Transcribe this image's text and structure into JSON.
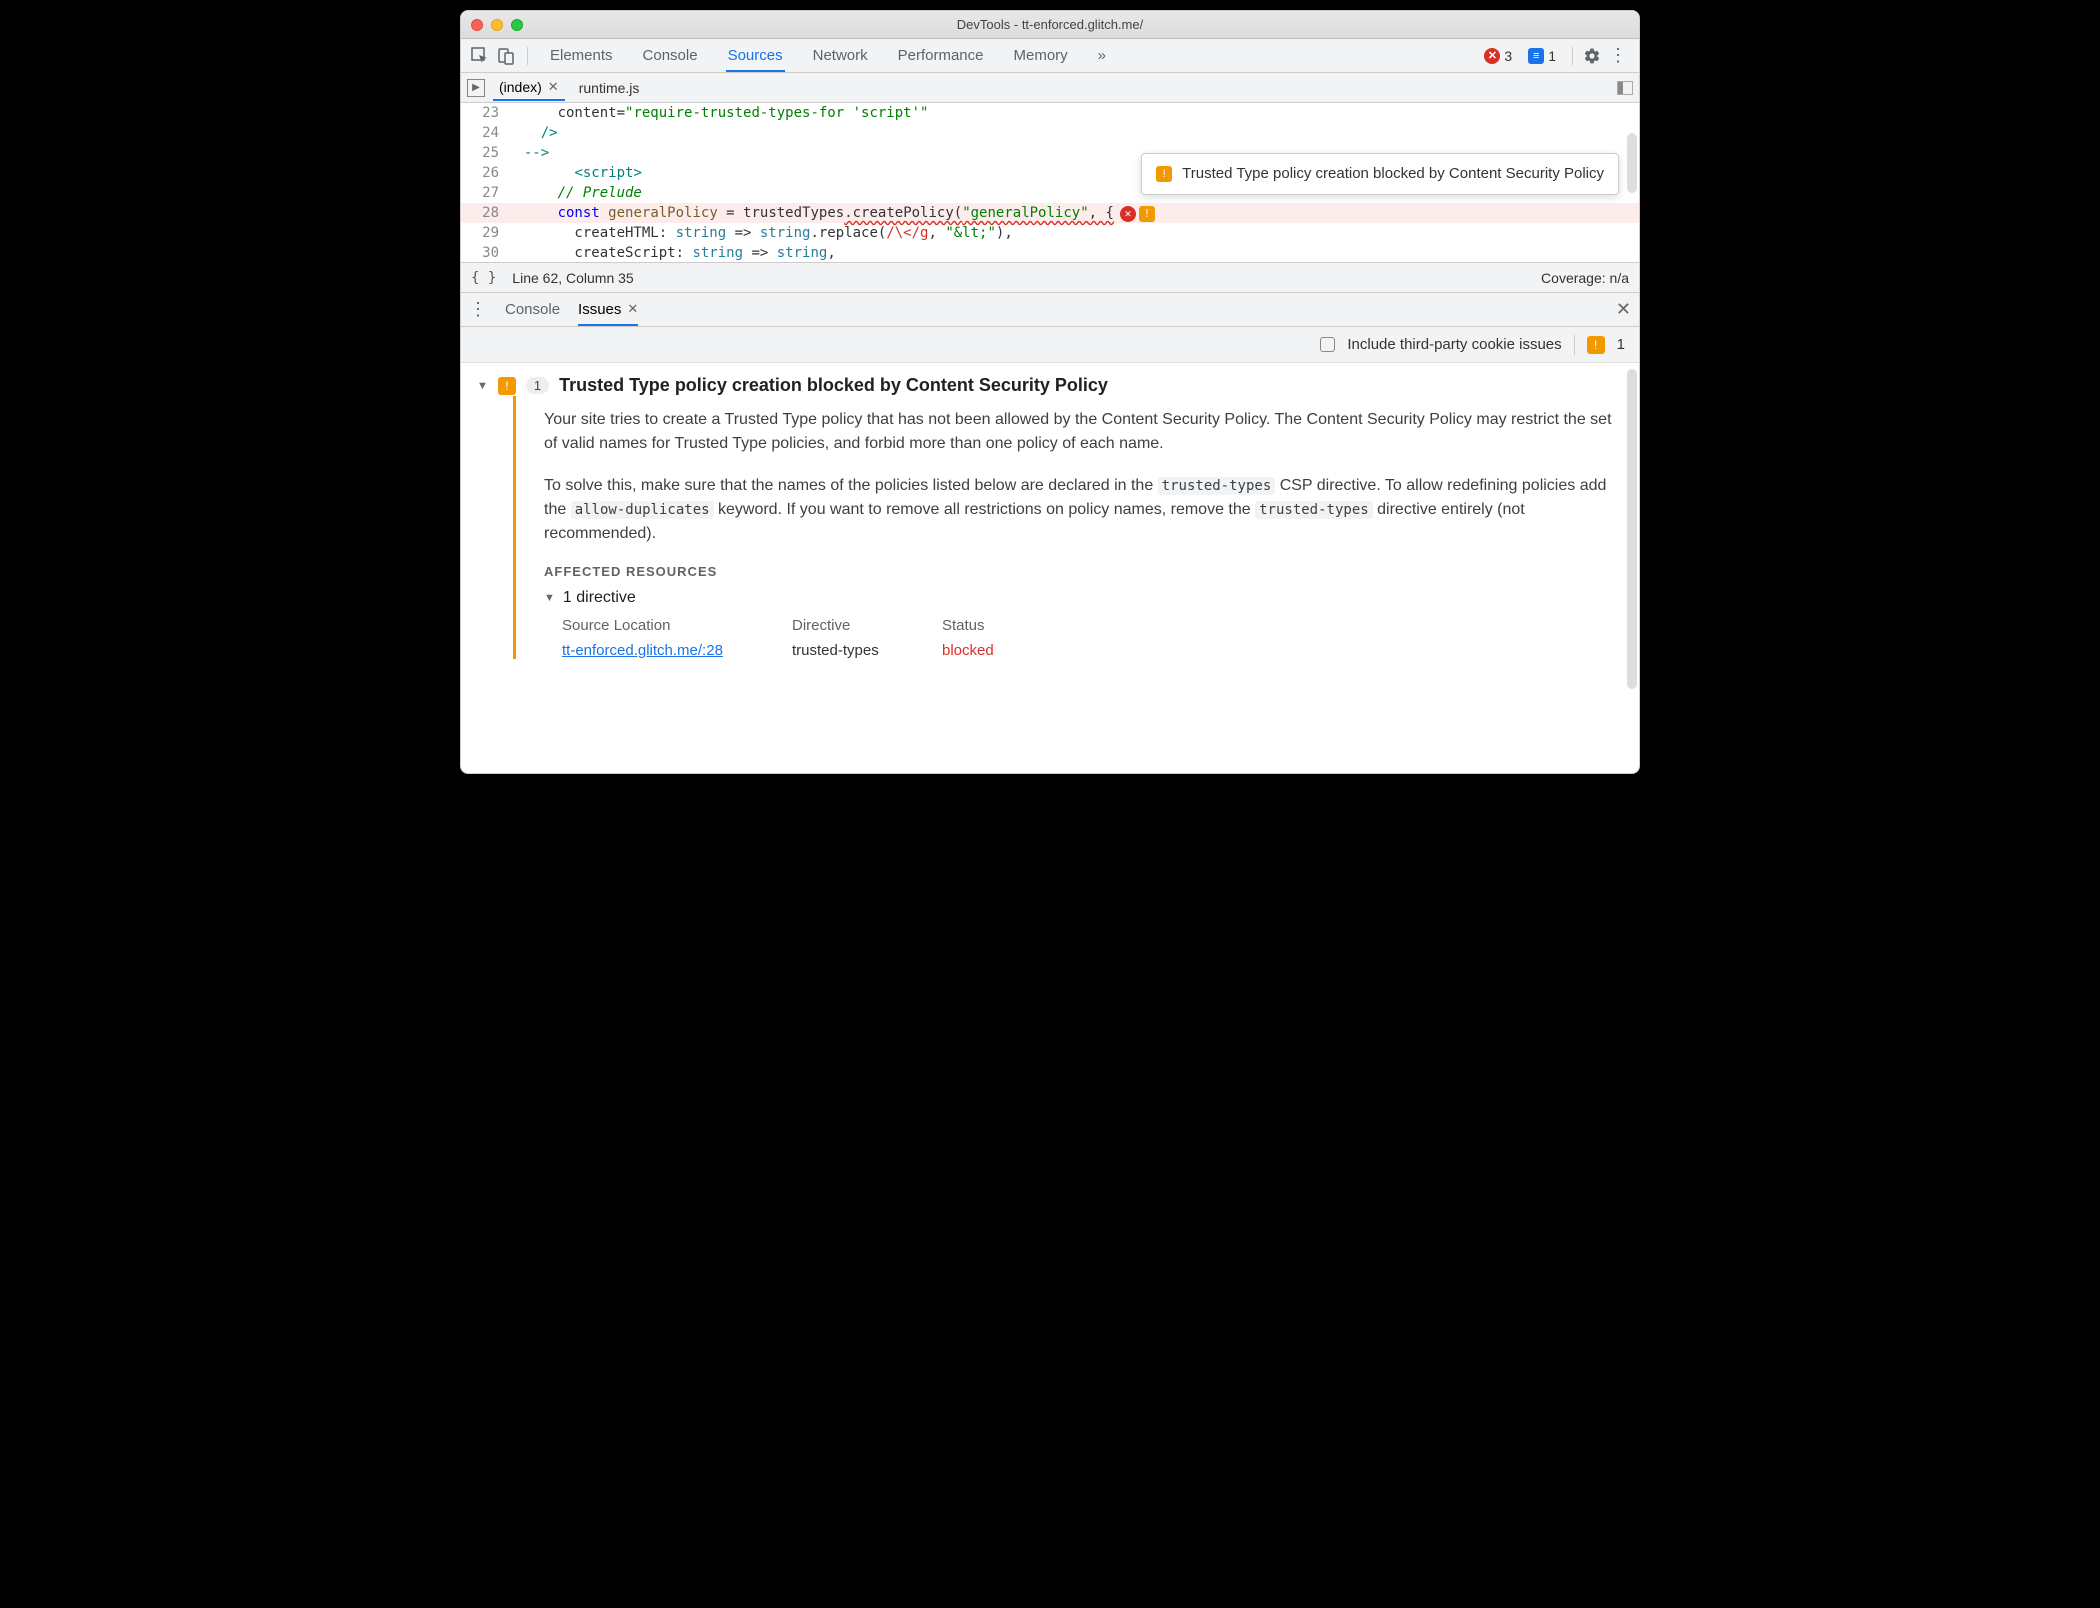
{
  "window": {
    "title": "DevTools - tt-enforced.glitch.me/"
  },
  "toolbar": {
    "tabs": [
      "Elements",
      "Console",
      "Sources",
      "Network",
      "Performance",
      "Memory"
    ],
    "activeTab": "Sources",
    "overflow": "»",
    "errorCount": "3",
    "messageCount": "1"
  },
  "fileTabs": {
    "items": [
      {
        "label": "(index)",
        "active": true,
        "closeable": true
      },
      {
        "label": "runtime.js",
        "active": false,
        "closeable": false
      }
    ]
  },
  "code": {
    "lines": [
      {
        "n": "23",
        "html": "      content=<span class='k-str'>\"require-trusted-types-for 'script'\"</span>"
      },
      {
        "n": "24",
        "html": "    <span class='k-tag'>/&gt;</span>"
      },
      {
        "n": "25",
        "html": "  <span class='k-tag'>--&gt;</span>"
      },
      {
        "n": "26",
        "html": "        <span class='k-tag'>&lt;script&gt;</span>"
      },
      {
        "n": "27",
        "html": "      <span class='k-comment'>// Prelude</span>"
      },
      {
        "n": "28",
        "hl": true,
        "html": "      <span class='k-kw'>const</span> <span class='k-var'>generalPolicy</span> = trustedTypes<span class='squig'>.createPolicy(</span><span class='k-str squig'>\"generalPolicy\"</span><span class='squig'>, {</span><span class='ln-err'><span class='lerr'>✕</span><span class='lwarn'>!</span></span>"
      },
      {
        "n": "29",
        "html": "        createHTML: <span class='k-type'>string</span> =&gt; <span class='k-type'>string</span>.replace(<span class='k-regex'>/\\&lt;/g</span>, <span class='k-str'>\"&amp;lt;\"</span>),"
      },
      {
        "n": "30",
        "html": "        createScript: <span class='k-type'>string</span> =&gt; <span class='k-type'>string</span>,"
      }
    ]
  },
  "tooltip": {
    "text": "Trusted Type policy creation blocked by Content Security Policy"
  },
  "status": {
    "pos": "Line 62, Column 35",
    "coverage": "Coverage: n/a"
  },
  "drawer": {
    "tabs": [
      "Console",
      "Issues"
    ],
    "activeTab": "Issues",
    "filterLabel": "Include third-party cookie issues",
    "warnCount": "1"
  },
  "issue": {
    "count": "1",
    "title": "Trusted Type policy creation blocked by Content Security Policy",
    "p1a": "Your site tries to create a Trusted Type policy that has not been allowed by the Content Security Policy. The Content Security Policy may restrict the set of valid names for Trusted Type policies, and forbid more than one policy of each name.",
    "p2_1": "To solve this, make sure that the names of the policies listed below are declared in the ",
    "p2_c1": "trusted-types",
    "p2_2": " CSP directive. To allow redefining policies add the ",
    "p2_c2": "allow-duplicates",
    "p2_3": " keyword. If you want to remove all restrictions on policy names, remove the ",
    "p2_c3": "trusted-types",
    "p2_4": " directive entirely (not recommended).",
    "affectedHeader": "AFFECTED RESOURCES",
    "directiveSummary": "1 directive",
    "table": {
      "h1": "Source Location",
      "h2": "Directive",
      "h3": "Status",
      "r1": "tt-enforced.glitch.me/:28",
      "r2": "trusted-types",
      "r3": "blocked"
    }
  }
}
